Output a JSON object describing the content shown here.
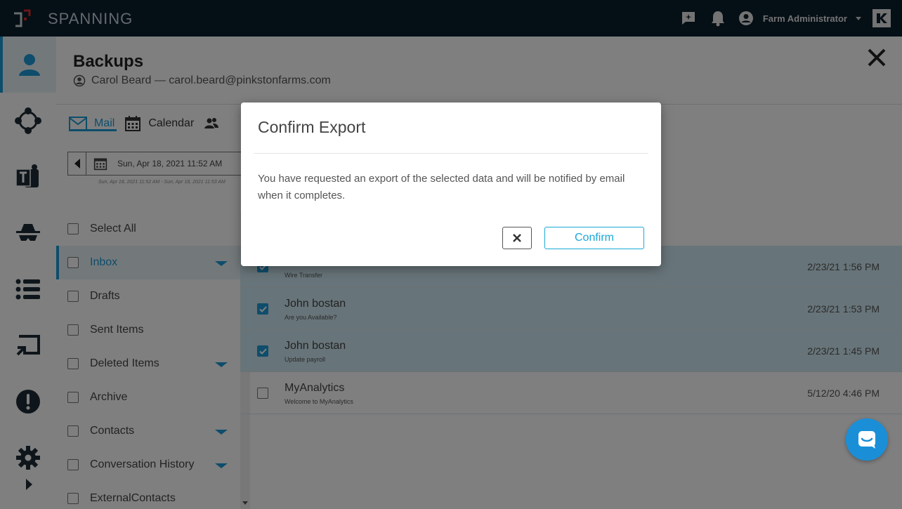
{
  "header": {
    "brand": "SPANNING",
    "user_name": "Farm Administrator",
    "icons": [
      "feedback-icon",
      "bell-icon",
      "user-circle-icon",
      "kaseya-logo-icon"
    ]
  },
  "rail": {
    "items": [
      {
        "name": "user-icon",
        "active": true
      },
      {
        "name": "hub-icon"
      },
      {
        "name": "teams-icon"
      },
      {
        "name": "spy-icon"
      },
      {
        "name": "list-icon"
      },
      {
        "name": "restore-icon"
      },
      {
        "name": "alert-icon"
      },
      {
        "name": "gear-icon"
      }
    ]
  },
  "page": {
    "title": "Backups",
    "subtitle": "Carol Beard — carol.beard@pinkstonfarms.com"
  },
  "tabs": [
    {
      "label": "Mail",
      "active": true
    },
    {
      "label": "Calendar"
    }
  ],
  "date": {
    "value": "Sun, Apr 18, 2021 11:52 AM",
    "range": "Sun, Apr 18, 2021 11:52 AM - Sun, Apr 18, 2021 11:53 AM"
  },
  "folders": [
    {
      "label": "Select All",
      "expand": false
    },
    {
      "label": "Inbox",
      "active": true,
      "expand": true
    },
    {
      "label": "Drafts",
      "expand": false
    },
    {
      "label": "Sent Items",
      "expand": false
    },
    {
      "label": "Deleted Items",
      "expand": true
    },
    {
      "label": "Archive",
      "expand": false
    },
    {
      "label": "Contacts",
      "expand": true
    },
    {
      "label": "Conversation History",
      "expand": true
    },
    {
      "label": "ExternalContacts",
      "expand": false
    }
  ],
  "emails": [
    {
      "from": "",
      "subject": "Wire Transfer",
      "date": "2/23/21 1:56 PM",
      "checked": true
    },
    {
      "from": "John bostan",
      "subject": "Are you Available?",
      "date": "2/23/21 1:53 PM",
      "checked": true
    },
    {
      "from": "John bostan",
      "subject": "Update payroll",
      "date": "2/23/21 1:45 PM",
      "checked": true
    },
    {
      "from": "MyAnalytics",
      "subject": "Welcome to MyAnalytics",
      "date": "5/12/20 4:46 PM",
      "checked": false
    }
  ],
  "modal": {
    "title": "Confirm Export",
    "body": "You have requested an export of the selected data and will be notified by email when it completes.",
    "confirm_label": "Confirm"
  },
  "colors": {
    "accent": "#1d9ad6",
    "topbar": "#0b1f2c",
    "selected_row": "#cfe8f2",
    "chat": "#1a8fd8"
  }
}
